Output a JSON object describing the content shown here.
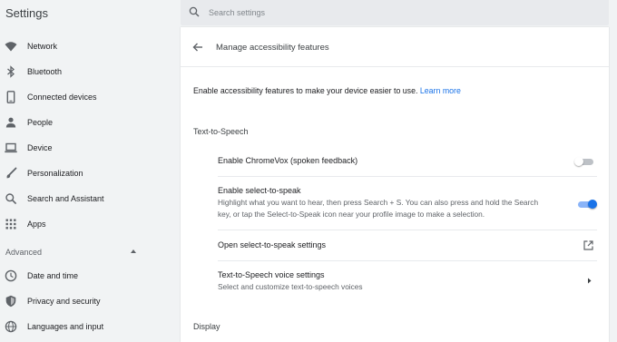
{
  "header": {
    "title": "Settings",
    "search": {
      "placeholder": "Search settings",
      "value": ""
    }
  },
  "sidebar": {
    "items": [
      {
        "label": "Network",
        "icon": "wifi-icon"
      },
      {
        "label": "Bluetooth",
        "icon": "bluetooth-icon"
      },
      {
        "label": "Connected devices",
        "icon": "phone-icon"
      },
      {
        "label": "People",
        "icon": "person-icon"
      },
      {
        "label": "Device",
        "icon": "laptop-icon"
      },
      {
        "label": "Personalization",
        "icon": "brush-icon"
      },
      {
        "label": "Search and Assistant",
        "icon": "search-icon"
      },
      {
        "label": "Apps",
        "icon": "apps-grid-icon"
      }
    ],
    "advanced": {
      "label": "Advanced",
      "expanded": true
    },
    "advanced_items": [
      {
        "label": "Date and time",
        "icon": "clock-icon"
      },
      {
        "label": "Privacy and security",
        "icon": "shield-icon"
      },
      {
        "label": "Languages and input",
        "icon": "globe-icon"
      }
    ]
  },
  "main": {
    "title": "Manage accessibility features",
    "intro": "Enable accessibility features to make your device easier to use.",
    "learn_more": "Learn more",
    "sections": [
      {
        "title": "Text-to-Speech",
        "rows": [
          {
            "title": "Enable ChromeVox (spoken feedback)",
            "control": "toggle",
            "on": false
          },
          {
            "title": "Enable select-to-speak",
            "desc_line1": "Highlight what you want to hear, then press Search + S. You can also press and hold the Search",
            "desc_line2": "key, or tap the Select-to-Speak icon near your profile image to make a selection.",
            "control": "toggle",
            "on": true
          },
          {
            "title": "Open select-to-speak settings",
            "control": "external-link-icon"
          },
          {
            "title": "Text-to-Speech voice settings",
            "desc": "Select and customize text-to-speech voices",
            "control": "chevron-right-icon"
          }
        ]
      },
      {
        "title": "Display"
      }
    ]
  },
  "colors": {
    "accent": "#1a73e8",
    "background": "#f1f3f4",
    "card": "#ffffff",
    "toggle_on_track": "#8ab4f8",
    "toggle_off_track": "#bdc1c6"
  }
}
